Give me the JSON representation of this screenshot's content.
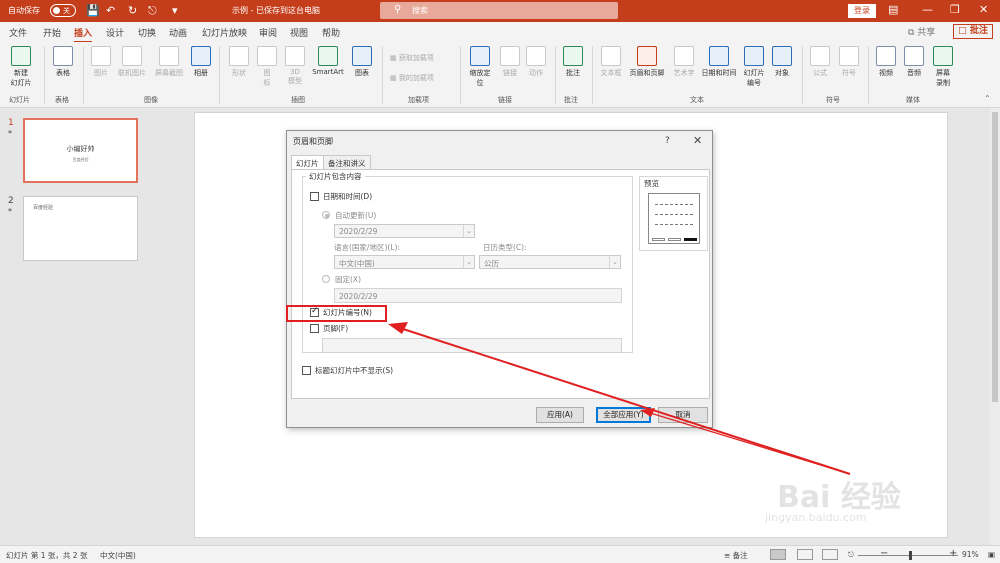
{
  "titlebar": {
    "autosave_label": "自动保存",
    "autosave_state": "关",
    "document_title": "示例 - 已保存到这台电脑",
    "search_placeholder": "搜索",
    "login_label": "登录"
  },
  "menu": {
    "items": [
      "文件",
      "开始",
      "插入",
      "设计",
      "切换",
      "动画",
      "幻灯片放映",
      "审阅",
      "视图",
      "帮助"
    ],
    "active": "插入",
    "share_label": "共享",
    "comment_label": "批注"
  },
  "ribbon": {
    "buttons": {
      "new_slide": "新建\n幻灯片",
      "table": "表格",
      "pictures": "图片",
      "online_pictures": "联机图片",
      "screenshot": "屏幕截图",
      "album": "相册",
      "shapes": "形状",
      "icons": "图\n标",
      "model3d": "3D\n模型",
      "smartart": "SmartArt",
      "chart": "图表",
      "get_addins": "获取加载项",
      "my_addins": "我的加载项",
      "zoom": "缩放定\n位",
      "link": "链接",
      "action": "动作",
      "comment": "批注",
      "textbox": "文本框",
      "header_footer": "页眉和页脚",
      "wordart": "艺术字",
      "date_time": "日期和时间",
      "slide_number": "幻灯片\n编号",
      "object": "对象",
      "equation": "公式",
      "symbol": "符号",
      "video": "视频",
      "audio": "音频",
      "screen_recording": "屏幕\n录制"
    },
    "groups": {
      "slides": "幻灯片",
      "tables": "表格",
      "images": "图像",
      "illustrations": "插图",
      "addins": "加载项",
      "links": "链接",
      "comments": "批注",
      "text": "文本",
      "symbols": "符号",
      "media": "媒体"
    }
  },
  "thumbnails": [
    {
      "number": "1",
      "title": "小编好帅",
      "subtitle": "百度经验"
    },
    {
      "number": "2",
      "title": "百度经验"
    }
  ],
  "dialog": {
    "title": "页眉和页脚",
    "help": "?",
    "tabs": [
      "幻灯片",
      "备注和讲义"
    ],
    "section_label": "幻灯片包含内容",
    "date_time_label": "日期和时间(D)",
    "date_time_checked": false,
    "auto_update_label": "自动更新(U)",
    "auto_update_value": "2020/2/29",
    "language_label": "语言(国家/地区)(L):",
    "language_value": "中文(中国)",
    "calendar_label": "日历类型(C):",
    "calendar_value": "公历",
    "fixed_label": "固定(X)",
    "fixed_value": "2020/2/29",
    "slide_number_label": "幻灯片编号(N)",
    "slide_number_checked": true,
    "footer_label": "页脚(F)",
    "footer_checked": false,
    "footer_value": "",
    "title_slide_label": "标题幻灯片中不显示(S)",
    "title_slide_checked": false,
    "preview_label": "预览",
    "apply_label": "应用(A)",
    "apply_all_label": "全部应用(Y)",
    "cancel_label": "取消"
  },
  "statusbar": {
    "slide_info": "幻灯片 第 1 张，共 2 张",
    "language": "中文(中国)",
    "notes_label": "备注",
    "zoom": "91%"
  },
  "watermark": {
    "brand": "Bai 经验",
    "url": "jingyan.baidu.com"
  },
  "colors": {
    "accent": "#c43e1c",
    "highlight": "#e02020",
    "primary_button": "#0078d7"
  }
}
